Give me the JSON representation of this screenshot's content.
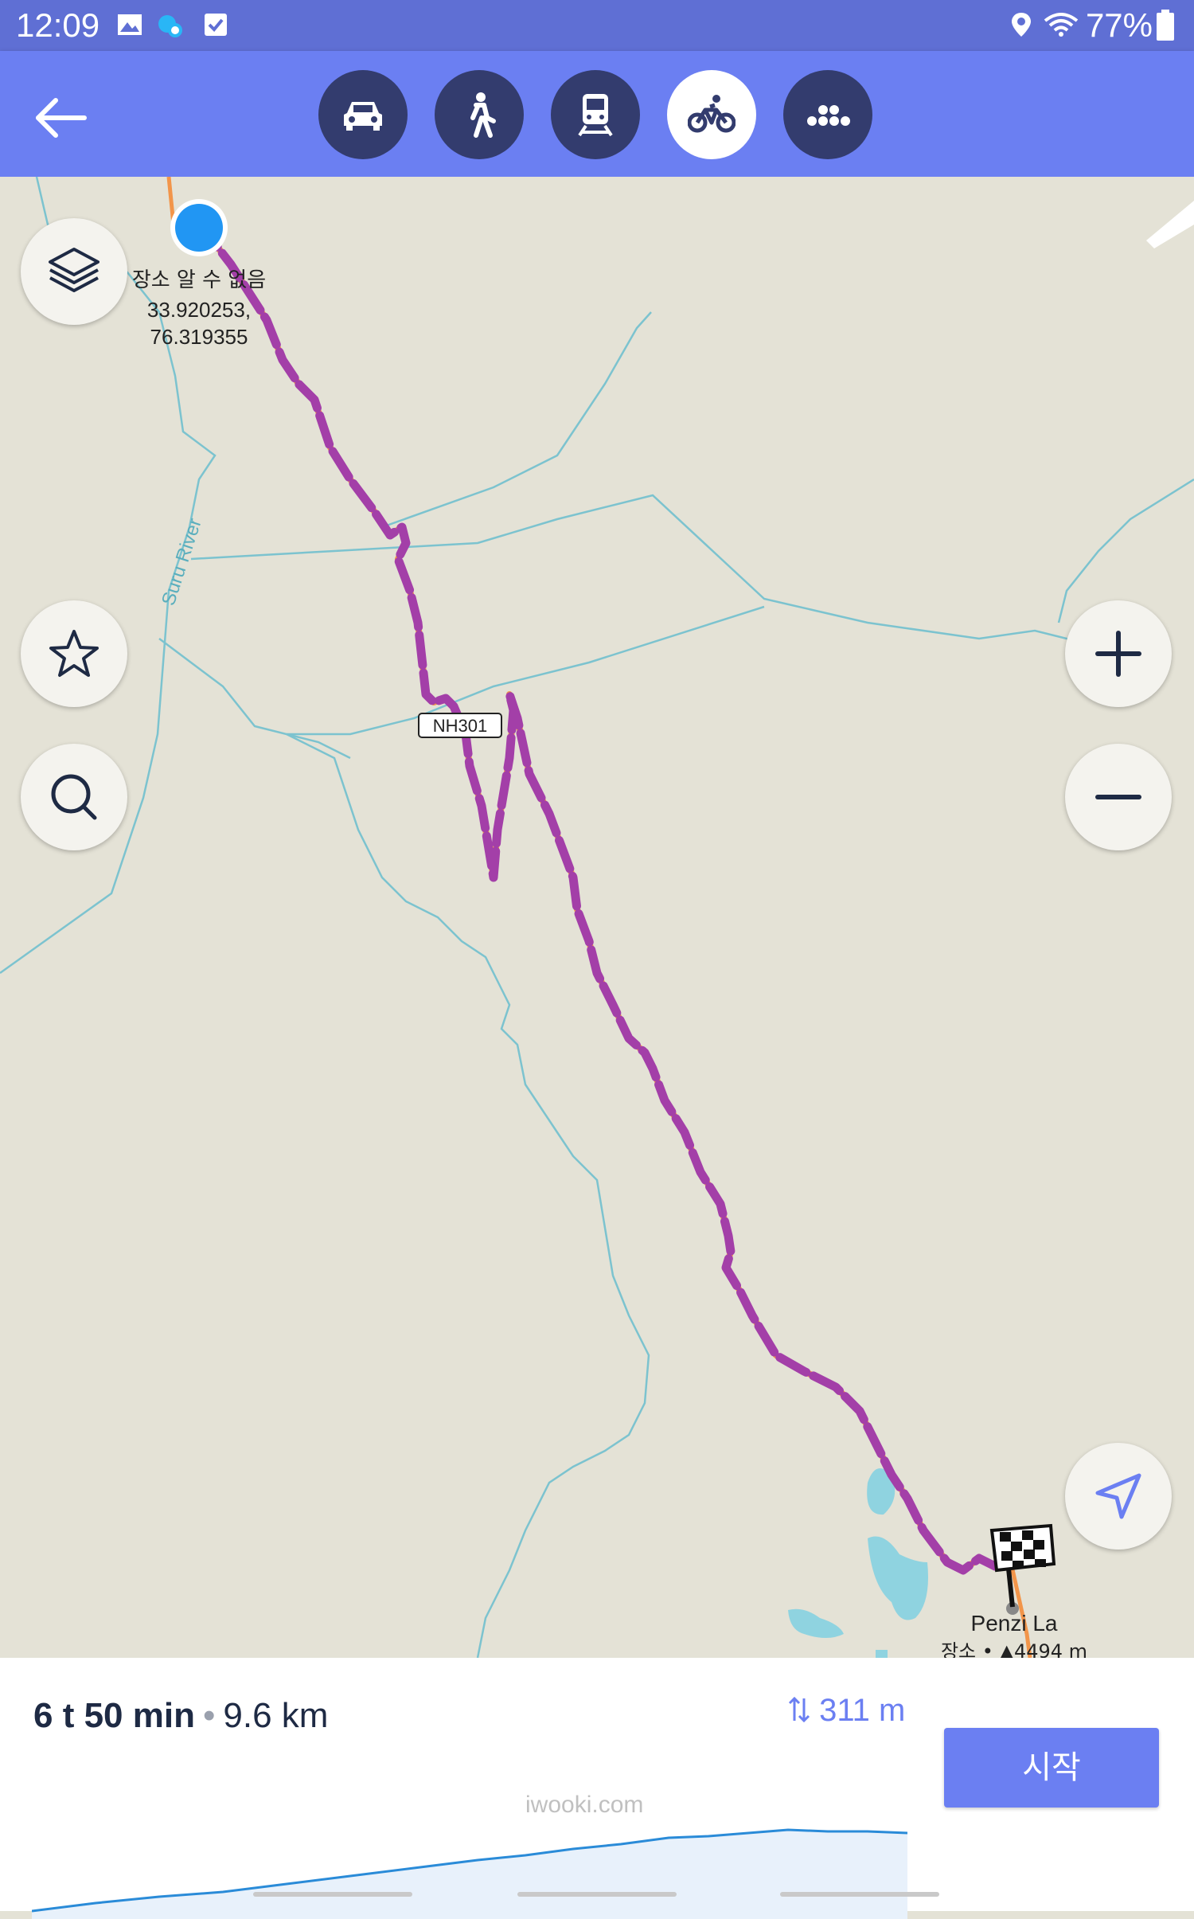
{
  "status_bar": {
    "time": "12:09",
    "battery": "77%",
    "icons": [
      "image-icon",
      "cloud-sync-icon",
      "checkbox-icon",
      "location-icon",
      "wifi-icon",
      "battery-icon"
    ]
  },
  "top_bar": {
    "back_icon": "arrow-left-icon",
    "modes": [
      {
        "id": "car",
        "icon": "car-icon",
        "active": false
      },
      {
        "id": "walk",
        "icon": "pedestrian-icon",
        "active": false
      },
      {
        "id": "transit",
        "icon": "train-icon",
        "active": false
      },
      {
        "id": "bike",
        "icon": "bicycle-icon",
        "active": true
      },
      {
        "id": "taxi",
        "icon": "taxi-icon",
        "active": false
      }
    ]
  },
  "map": {
    "start_marker": {
      "label": "장소 알 수 없음",
      "coords_line1": "33.920253,",
      "coords_line2": "76.319355"
    },
    "river_label": "Suru River",
    "road_label": "NH301",
    "destination": {
      "name": "Penzi La",
      "subtitle": "장소 • ▲4494 m",
      "icon": "checkered-flag-icon"
    },
    "colors": {
      "route": "#a33fa8",
      "route_dash": "#f2954a",
      "water": "#8fd3e0",
      "land": "#e4e2d6",
      "accent": "#6b7ff2",
      "location_dot": "#2196f3"
    }
  },
  "controls": {
    "layers_icon": "layers-icon",
    "favorite_icon": "star-icon",
    "search_icon": "search-icon",
    "zoom_in_icon": "plus-icon",
    "zoom_out_icon": "minus-icon",
    "my_location_icon": "navigation-arrow-icon"
  },
  "route_summary": {
    "duration": "6 t 50 min",
    "separator": "•",
    "distance": "9.6 km",
    "elevation_gain": "311 m",
    "elevation_icon": "up-down-arrows-icon",
    "start_label": "시작"
  },
  "watermark": "iwooki.com"
}
